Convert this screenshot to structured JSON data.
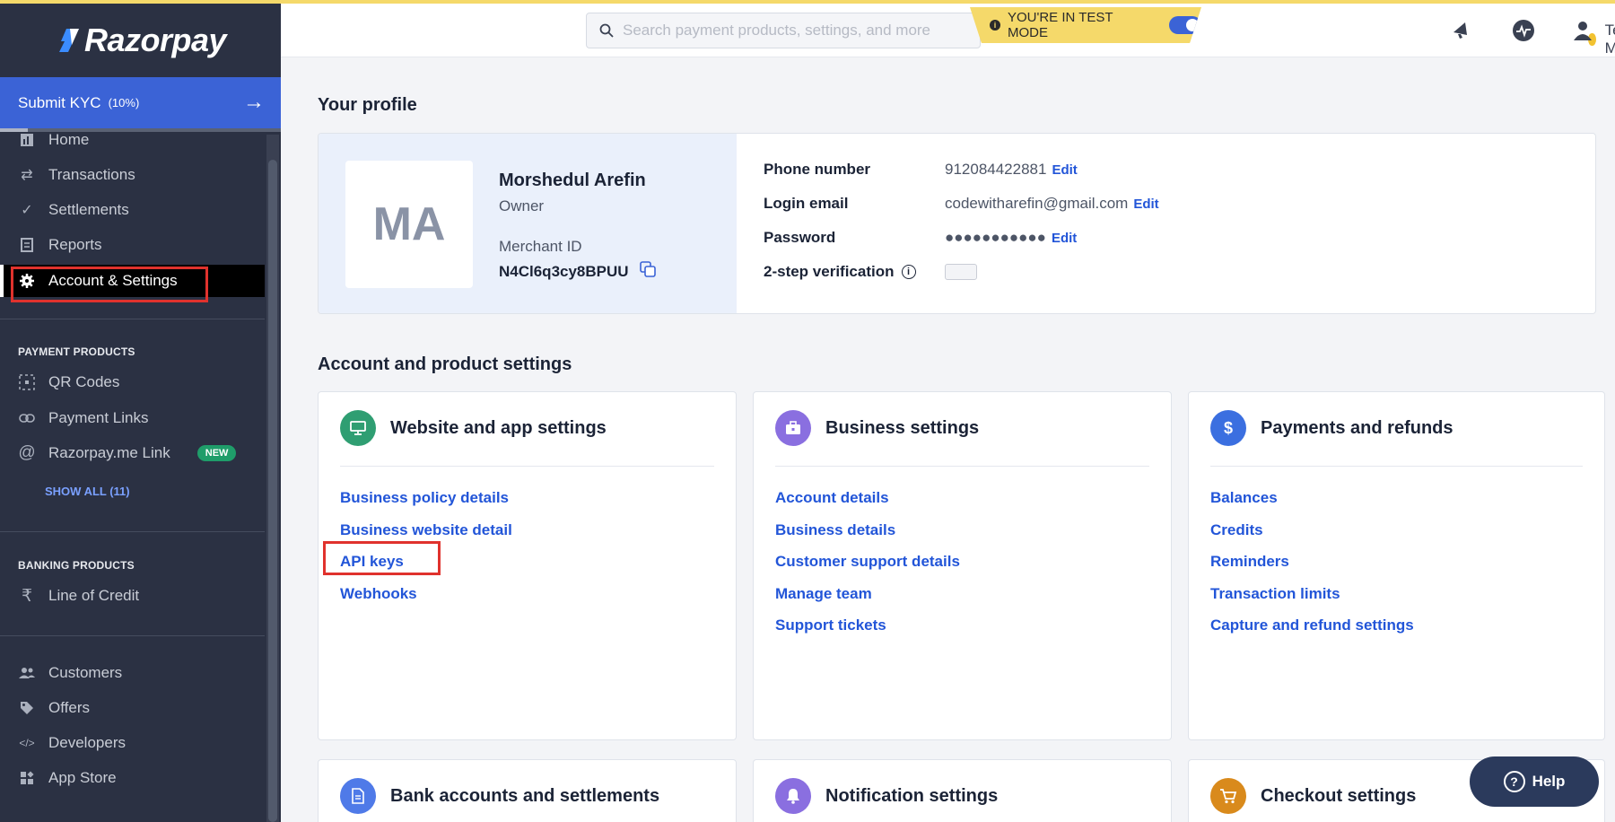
{
  "brand": {
    "name": "Razorpay"
  },
  "kyc": {
    "label": "Submit KYC",
    "percent": "(10%)",
    "progress": 0.1
  },
  "sidebar": {
    "items": [
      {
        "label": "Home",
        "icon": "home-icon"
      },
      {
        "label": "Transactions",
        "icon": "transactions-icon"
      },
      {
        "label": "Settlements",
        "icon": "settlements-icon"
      },
      {
        "label": "Reports",
        "icon": "reports-icon"
      },
      {
        "label": "Account & Settings",
        "icon": "gear-icon",
        "active": true
      }
    ],
    "payment_products": {
      "heading": "PAYMENT PRODUCTS",
      "items": [
        {
          "label": "QR Codes",
          "icon": "qr-code-icon"
        },
        {
          "label": "Payment Links",
          "icon": "link-icon"
        },
        {
          "label": "Razorpay.me Link",
          "icon": "at-icon",
          "badge": "NEW"
        }
      ],
      "show_all": "SHOW ALL (11)"
    },
    "banking_products": {
      "heading": "BANKING PRODUCTS",
      "items": [
        {
          "label": "Line of Credit",
          "icon": "rupee-icon"
        }
      ]
    },
    "more": [
      {
        "label": "Customers",
        "icon": "customers-icon"
      },
      {
        "label": "Offers",
        "icon": "tag-icon"
      },
      {
        "label": "Developers",
        "icon": "code-icon"
      },
      {
        "label": "App Store",
        "icon": "app-store-icon"
      }
    ]
  },
  "topbar": {
    "search_placeholder": "Search payment products, settings, and more",
    "test_mode_banner": "YOU'RE IN TEST MODE",
    "test_mode_on": true,
    "mode_select": "Test Mode"
  },
  "profile": {
    "section_title": "Your profile",
    "initials": "MA",
    "name": "Morshedul Arefin",
    "role": "Owner",
    "merchant_id_label": "Merchant ID",
    "merchant_id": "N4Cl6q3cy8BPUU",
    "phone_label": "Phone number",
    "phone": "912084422881",
    "email_label": "Login email",
    "email": "codewitharefin@gmail.com",
    "password_label": "Password",
    "password": "●●●●●●●●●●●",
    "two_step_label": "2-step verification",
    "edit_label": "Edit"
  },
  "settings": {
    "section_title": "Account and product settings",
    "cards": [
      {
        "title": "Website and app settings",
        "icon": "monitor-icon",
        "color": "#2f9e72",
        "links": [
          "Business policy details",
          "Business website detail",
          "API keys",
          "Webhooks"
        ]
      },
      {
        "title": "Business settings",
        "icon": "briefcase-icon",
        "color": "#8a6fe0",
        "links": [
          "Account details",
          "Business details",
          "Customer support details",
          "Manage team",
          "Support tickets"
        ]
      },
      {
        "title": "Payments and refunds",
        "icon": "dollar-icon",
        "color": "#3b6fe0",
        "links": [
          "Balances",
          "Credits",
          "Reminders",
          "Transaction limits",
          "Capture and refund settings"
        ]
      },
      {
        "title": "Bank accounts and settlements",
        "icon": "document-icon",
        "color": "#4f7ae8",
        "links": []
      },
      {
        "title": "Notification settings",
        "icon": "bell-icon",
        "color": "#8a6fe0",
        "links": []
      },
      {
        "title": "Checkout settings",
        "icon": "cart-icon",
        "color": "#d98a1c",
        "links": []
      }
    ]
  },
  "help": {
    "label": "Help"
  }
}
